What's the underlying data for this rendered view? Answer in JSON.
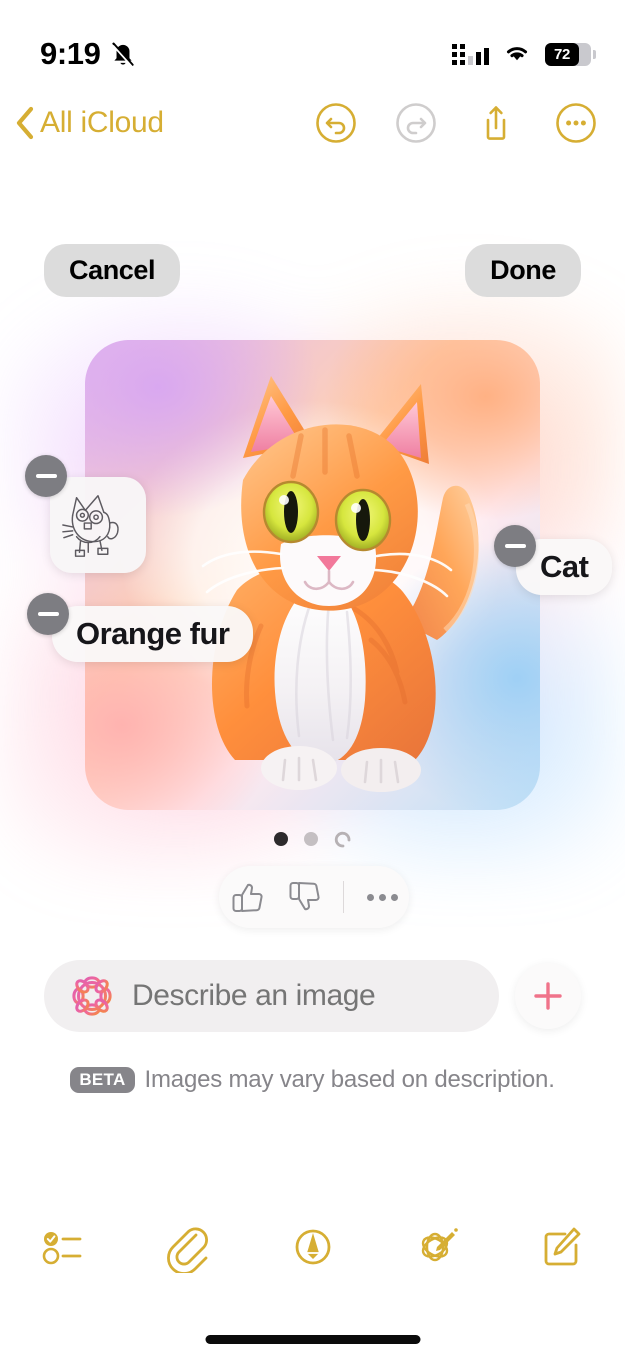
{
  "status_bar": {
    "time": "9:19",
    "silent_icon": "bell-slash-icon",
    "signal_icon": "cellular-signal-icon",
    "wifi_icon": "wifi-icon",
    "battery_percent": "72"
  },
  "nav_bar": {
    "back_label": "All iCloud",
    "back_icon": "chevron-left-icon",
    "accent_color": "#d6ae33",
    "actions": [
      {
        "name": "undo-button",
        "icon": "undo-icon",
        "enabled": true
      },
      {
        "name": "redo-button",
        "icon": "redo-icon",
        "enabled": false
      },
      {
        "name": "share-button",
        "icon": "share-icon",
        "enabled": true
      },
      {
        "name": "more-button",
        "icon": "ellipsis-circle-icon",
        "enabled": true
      }
    ]
  },
  "playground": {
    "cancel_label": "Cancel",
    "done_label": "Done",
    "concept_chips": [
      {
        "name": "sketch-chip",
        "type": "sketch",
        "label": "",
        "remove_icon": "minus-icon"
      },
      {
        "name": "orange-fur-chip",
        "type": "text",
        "label": "Orange fur",
        "remove_icon": "minus-icon"
      },
      {
        "name": "cat-chip",
        "type": "text",
        "label": "Cat",
        "remove_icon": "minus-icon"
      }
    ],
    "pager": {
      "total_dots": 2,
      "active_index": 0,
      "loading_spinner": true
    },
    "feedback": {
      "thumbs_up_icon": "thumbs-up-icon",
      "thumbs_down_icon": "thumbs-down-icon",
      "more_icon": "ellipsis-icon"
    },
    "prompt": {
      "placeholder": "Describe an image",
      "value": "",
      "ai_icon": "apple-intelligence-icon",
      "add_icon": "plus-icon",
      "add_color": "#f0738a"
    },
    "disclaimer": {
      "badge": "BETA",
      "text": "Images may vary based on description."
    },
    "generated_image": {
      "subject": "orange-kitten-illustration",
      "background": "rainbow-gradient"
    }
  },
  "bottom_toolbar": [
    {
      "name": "checklist-button",
      "icon": "checklist-icon"
    },
    {
      "name": "attachment-button",
      "icon": "paperclip-icon"
    },
    {
      "name": "markup-button",
      "icon": "markup-pen-icon"
    },
    {
      "name": "image-playground-button",
      "icon": "image-playground-icon"
    },
    {
      "name": "compose-button",
      "icon": "compose-icon"
    }
  ]
}
